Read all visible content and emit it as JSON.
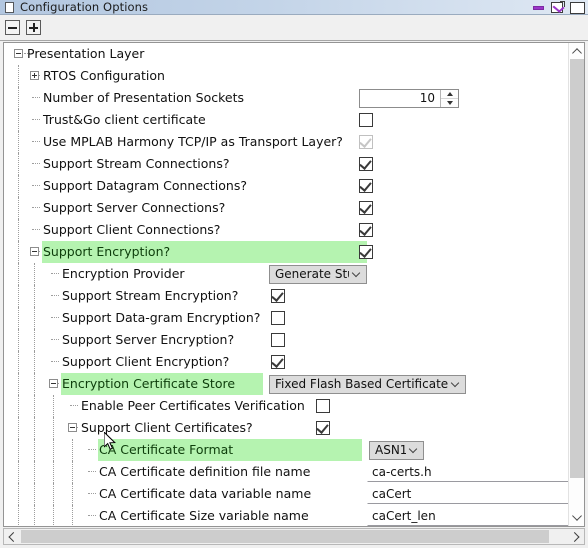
{
  "window": {
    "title": "Configuration Options",
    "icon": "document-icon",
    "controls": {
      "minimize": "minimize",
      "restore": "restore",
      "maximize": "maximize"
    }
  },
  "toolbar": {
    "collapse_all": "collapse-all",
    "expand_all": "expand-all"
  },
  "colors": {
    "highlight": "#b5f3b0",
    "titlebar": "#b3c7e0",
    "accent": "#9b35c9"
  },
  "tree": {
    "rows": [
      {
        "label": "Presentation Layer",
        "depth": 0,
        "expander": "minus",
        "control": "none",
        "highlight": false
      },
      {
        "label": "RTOS Configuration",
        "depth": 1,
        "expander": "plus",
        "control": "none",
        "highlight": false
      },
      {
        "label": "Number of Presentation Sockets",
        "depth": 1,
        "expander": "none",
        "control": "spinner",
        "value": "10",
        "highlight": false
      },
      {
        "label": "Trust&Go client certificate",
        "depth": 1,
        "expander": "none",
        "control": "checkbox",
        "checked": false,
        "disabled": false,
        "highlight": false
      },
      {
        "label": "Use MPLAB Harmony TCP/IP as Transport Layer?",
        "depth": 1,
        "expander": "none",
        "control": "checkbox",
        "checked": true,
        "disabled": true,
        "highlight": false
      },
      {
        "label": "Support Stream Connections?",
        "depth": 1,
        "expander": "none",
        "control": "checkbox",
        "checked": true,
        "disabled": false,
        "highlight": false
      },
      {
        "label": "Support Datagram Connections?",
        "depth": 1,
        "expander": "none",
        "control": "checkbox",
        "checked": true,
        "disabled": false,
        "highlight": false
      },
      {
        "label": "Support Server Connections?",
        "depth": 1,
        "expander": "none",
        "control": "checkbox",
        "checked": true,
        "disabled": false,
        "highlight": false
      },
      {
        "label": "Support Client Connections?",
        "depth": 1,
        "expander": "none",
        "control": "checkbox",
        "checked": true,
        "disabled": false,
        "highlight": false
      },
      {
        "label": "Support Encryption?",
        "depth": 1,
        "expander": "minus",
        "control": "checkbox",
        "checked": true,
        "disabled": false,
        "highlight": true,
        "highlight_width": 323
      },
      {
        "label": "Encryption Provider",
        "depth": 2,
        "expander": "none",
        "control": "combo",
        "value": "Generate Stub",
        "highlight": false
      },
      {
        "label": "Support Stream Encryption?",
        "depth": 2,
        "expander": "none",
        "control": "checkbox",
        "checked": true,
        "disabled": false,
        "highlight": false
      },
      {
        "label": "Support Data-gram Encryption?",
        "depth": 2,
        "expander": "none",
        "control": "checkbox",
        "checked": false,
        "disabled": false,
        "highlight": false
      },
      {
        "label": "Support Server Encryption?",
        "depth": 2,
        "expander": "none",
        "control": "checkbox",
        "checked": false,
        "disabled": false,
        "highlight": false
      },
      {
        "label": "Support Client Encryption?",
        "depth": 2,
        "expander": "none",
        "control": "checkbox",
        "checked": true,
        "disabled": false,
        "highlight": false
      },
      {
        "label": "Encryption Certificate Store",
        "depth": 2,
        "expander": "minus",
        "control": "combo-wide",
        "value": "Fixed Flash Based Certificate Repo",
        "highlight": true,
        "highlight_width": 200
      },
      {
        "label": "Enable Peer Certificates Verification",
        "depth": 3,
        "expander": "none",
        "control": "checkbox",
        "checked": false,
        "disabled": false,
        "highlight": false
      },
      {
        "label": "Support Client Certificates?",
        "depth": 3,
        "expander": "minus",
        "control": "checkbox",
        "checked": true,
        "disabled": false,
        "highlight": false
      },
      {
        "label": "CA Certificate Format",
        "depth": 4,
        "expander": "none",
        "control": "combo-small",
        "value": "ASN1",
        "highlight": true,
        "highlight_width": 262
      },
      {
        "label": "CA Certificate definition file name",
        "depth": 4,
        "expander": "none",
        "control": "textfield",
        "value": "ca-certs.h",
        "highlight": false
      },
      {
        "label": "CA Certificate data variable name",
        "depth": 4,
        "expander": "none",
        "control": "textfield",
        "value": "caCert",
        "highlight": false
      },
      {
        "label": "CA Certificate Size variable name",
        "depth": 4,
        "expander": "none",
        "control": "textfield",
        "value": "caCert_len",
        "highlight": false
      }
    ]
  },
  "scrollbars": {
    "vertical": "vertical-scrollbar",
    "horizontal": "horizontal-scrollbar"
  }
}
